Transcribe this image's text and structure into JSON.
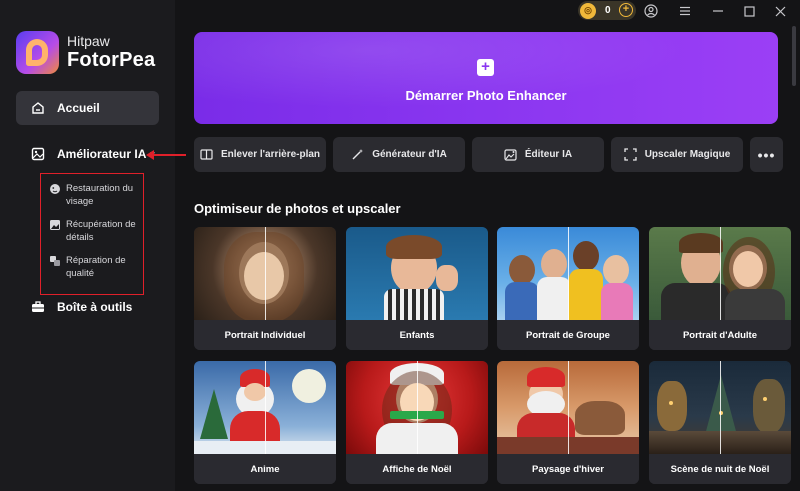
{
  "sidebar": {
    "brand": "Hitpaw",
    "product": "FotorPea",
    "home_label": "Accueil",
    "enhancer_label": "Améliorateur IA",
    "submenu": [
      {
        "label": "Restauration du visage",
        "line1": "Restauration du",
        "line2": "visage",
        "icon": "face-restore-icon"
      },
      {
        "label": "Récupération de détails",
        "line1": "Récupération de",
        "line2": "détails",
        "icon": "image-detail-icon"
      },
      {
        "label": "Réparation de qualité",
        "line1": "Réparation de",
        "line2": "qualité",
        "icon": "repair-icon"
      }
    ],
    "tools_label": "Boîte à outils"
  },
  "titlebar": {
    "coins": "0"
  },
  "hero": {
    "label": "Démarrer Photo Enhancer"
  },
  "tools": [
    {
      "label": "Enlever l'arrière-plan",
      "icon": "background-remove-icon"
    },
    {
      "label": "Générateur d'IA",
      "icon": "magic-wand-icon"
    },
    {
      "label": "Éditeur IA",
      "icon": "ai-editor-icon"
    },
    {
      "label": "Upscaler Magique",
      "icon": "expand-icon"
    },
    {
      "label": "",
      "icon": "more-icon"
    }
  ],
  "section_title": "Optimiseur de photos et upscaler",
  "cards": [
    {
      "label": "Portrait Individuel"
    },
    {
      "label": "Enfants"
    },
    {
      "label": "Portrait de Groupe"
    },
    {
      "label": "Portrait d'Adulte"
    },
    {
      "label": "Anime"
    },
    {
      "label": "Affiche de Noël"
    },
    {
      "label": "Paysage d'hiver"
    },
    {
      "label": "Scène de nuit de Noël"
    }
  ],
  "colors": {
    "accent": "#8a36f0",
    "highlight": "#e0202a",
    "sidebar": "#1b1b1e",
    "background": "#141416"
  }
}
